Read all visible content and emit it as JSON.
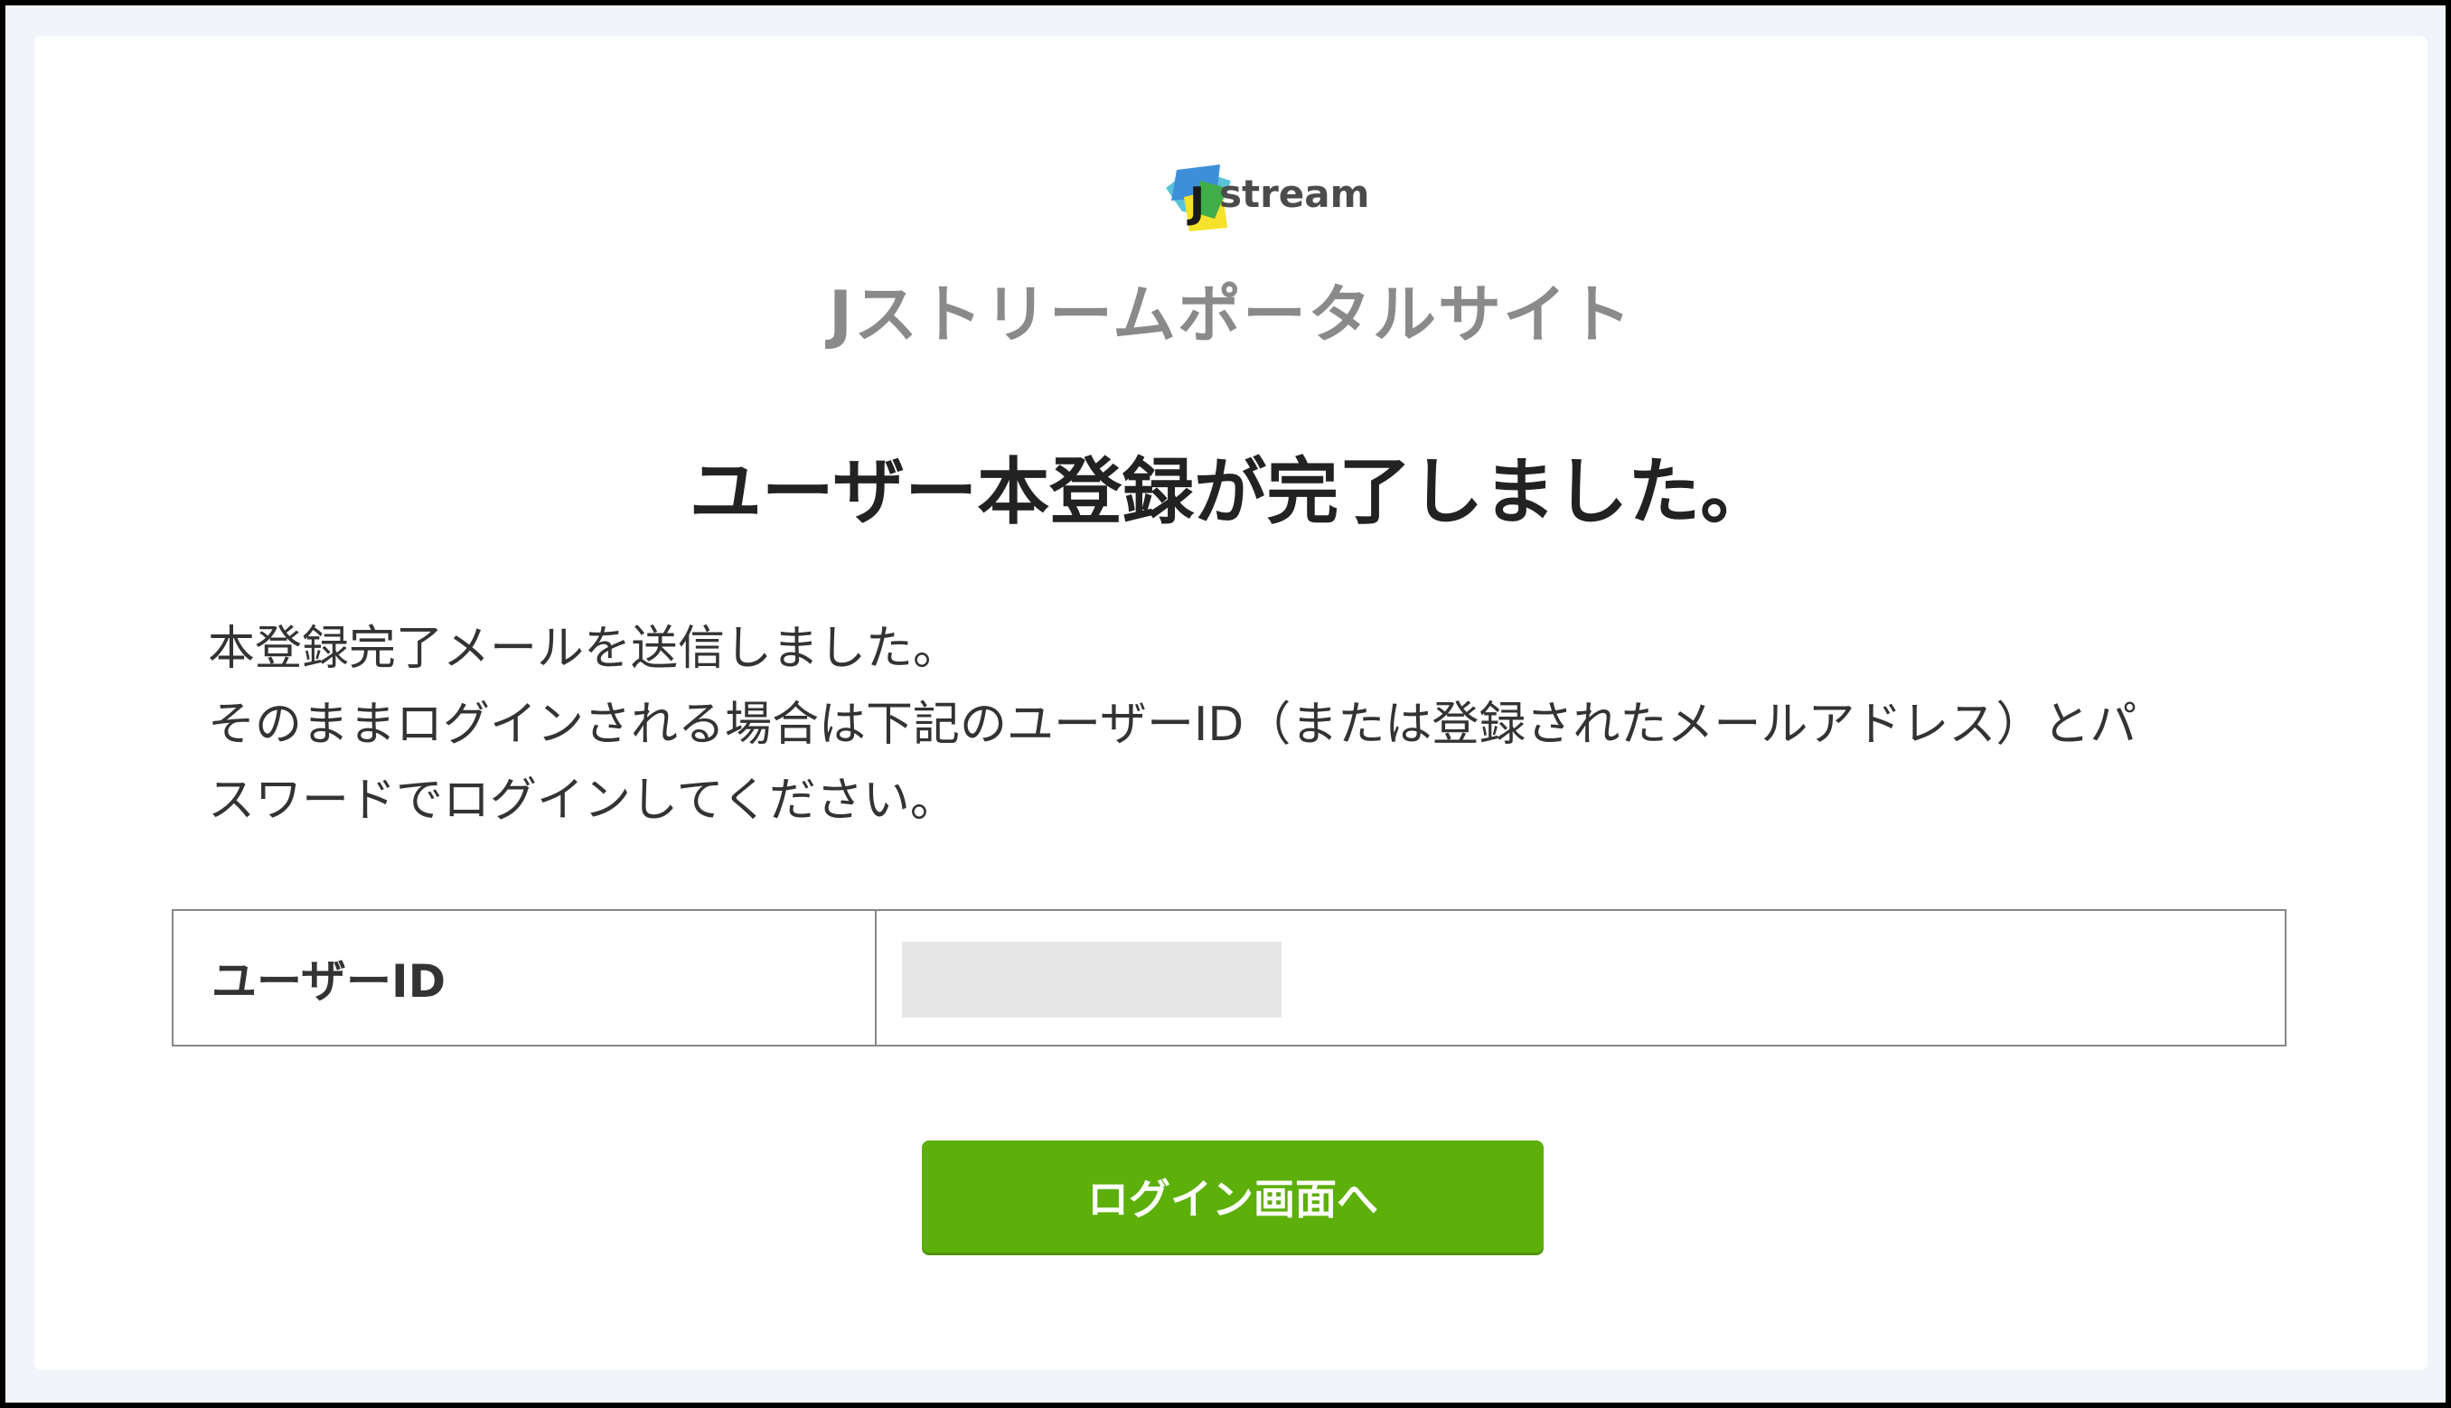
{
  "brand": {
    "logo_text": "stream",
    "logo_letter": "J",
    "logo_colors": {
      "blue": "#3d8fd9",
      "green": "#3fae49",
      "yellow": "#f5e22a",
      "cyan": "#5bc3d8"
    },
    "site_title": "Jストリームポータルサイト"
  },
  "page": {
    "heading": "ユーザー本登録が完了しました。",
    "message_lines": [
      "本登録完了メールを送信しました。",
      "そのままログインされる場合は下記のユーザーID（または登録されたメールアドレス）とパ",
      "スワードでログインしてください。"
    ]
  },
  "user_table": {
    "label": "ユーザーID",
    "value_redacted": true
  },
  "actions": {
    "login_button_label": "ログイン画面へ",
    "login_button_color": "#5daf0a"
  }
}
